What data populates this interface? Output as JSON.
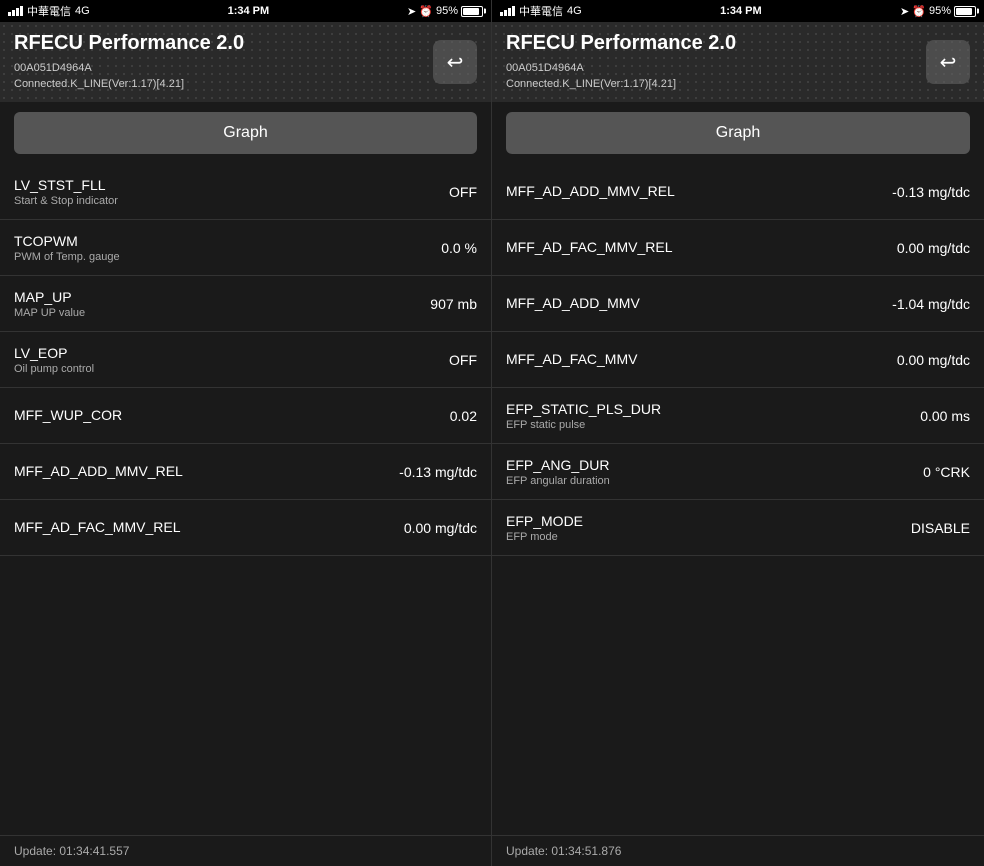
{
  "panel1": {
    "statusBar": {
      "carrier": "中華電信",
      "network": "4G",
      "time": "1:34 PM",
      "battery": "95%"
    },
    "header": {
      "title": "RFECU Performance 2.0",
      "deviceId": "00A051D4964A",
      "connection": "Connected.K_LINE(Ver:1.17)[4.21]",
      "backLabel": "←"
    },
    "graphButton": "Graph",
    "items": [
      {
        "name": "LV_STST_FLL",
        "desc": "Start & Stop indicator",
        "value": "OFF"
      },
      {
        "name": "TCOPWM",
        "desc": "PWM of Temp. gauge",
        "value": "0.0 %"
      },
      {
        "name": "MAP_UP",
        "desc": "MAP UP value",
        "value": "907 mb"
      },
      {
        "name": "LV_EOP",
        "desc": "Oil pump control",
        "value": "OFF"
      },
      {
        "name": "MFF_WUP_COR",
        "desc": "",
        "value": "0.02"
      },
      {
        "name": "MFF_AD_ADD_MMV_REL",
        "desc": "",
        "value": "-0.13 mg/tdc"
      },
      {
        "name": "MFF_AD_FAC_MMV_REL",
        "desc": "",
        "value": "0.00 mg/tdc"
      }
    ],
    "updateText": "Update: 01:34:41.557"
  },
  "panel2": {
    "statusBar": {
      "carrier": "中華電信",
      "network": "4G",
      "time": "1:34 PM",
      "battery": "95%"
    },
    "header": {
      "title": "RFECU Performance 2.0",
      "deviceId": "00A051D4964A",
      "connection": "Connected.K_LINE(Ver:1.17)[4.21]",
      "backLabel": "←"
    },
    "graphButton": "Graph",
    "items": [
      {
        "name": "MFF_AD_ADD_MMV_REL",
        "desc": "",
        "value": "-0.13 mg/tdc"
      },
      {
        "name": "MFF_AD_FAC_MMV_REL",
        "desc": "",
        "value": "0.00 mg/tdc"
      },
      {
        "name": "MFF_AD_ADD_MMV",
        "desc": "",
        "value": "-1.04 mg/tdc"
      },
      {
        "name": "MFF_AD_FAC_MMV",
        "desc": "",
        "value": "0.00 mg/tdc"
      },
      {
        "name": "EFP_STATIC_PLS_DUR",
        "desc": "EFP static pulse",
        "value": "0.00 ms"
      },
      {
        "name": "EFP_ANG_DUR",
        "desc": "EFP angular duration",
        "value": "0 °CRK"
      },
      {
        "name": "EFP_MODE",
        "desc": "EFP mode",
        "value": "DISABLE"
      }
    ],
    "updateText": "Update: 01:34:51.876"
  }
}
